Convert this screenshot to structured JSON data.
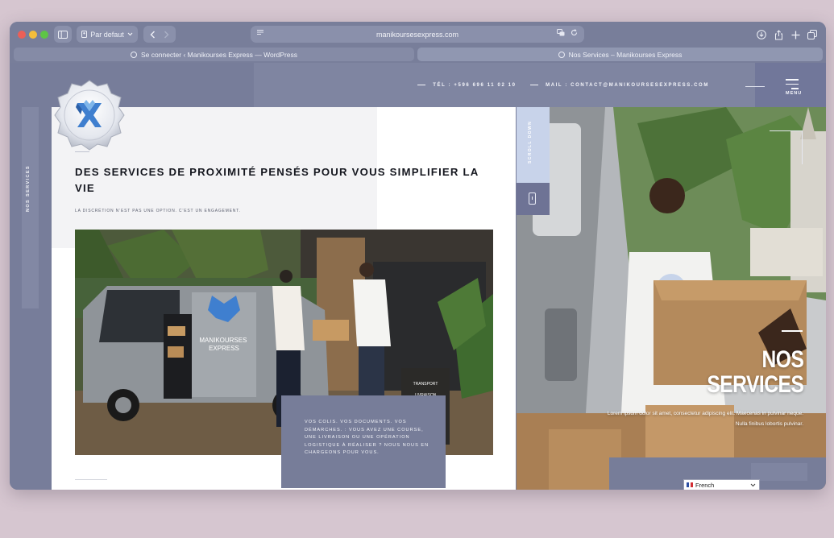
{
  "browser": {
    "profile_label": "Par defaut",
    "address": "manikoursesexpress.com",
    "tabs": [
      {
        "title": "Se connecter ‹ Manikourses Express — WordPress"
      },
      {
        "title": "Nos Services – Manikourses Express"
      }
    ]
  },
  "header": {
    "phone": "TÉL : +596 696 11 02 10",
    "email": "MAIL : CONTACT@MANIKOURSESEXPRESS.COM",
    "menu_label": "MENU"
  },
  "sidebar": {
    "label": "NOS SERVICES"
  },
  "main": {
    "heading": "DES SERVICES DE PROXIMITÉ PENSÉS POUR VOUS SIMPLIFIER LA VIE",
    "subheading": "LA DISCRÉTION N’EST PAS UNE OPTION. C’EST UN ENGAGEMENT.",
    "photo_van_text": "MANIKOURSES EXPRESS",
    "photo_sign_lines": [
      "TRANSPORT",
      "LIVRAISON"
    ],
    "card_text": "VOS COLIS. VOS DOCUMENTS. VOS DÉMARCHES. : VOUS AVEZ UNE COURSE, UNE LIVRAISON OU UNE OPÉRATION LOGISTIQUE À RÉALISER ? NOUS NOUS EN CHARGEONS POUR VOUS."
  },
  "scroll": {
    "label": "SCROLL DOWN"
  },
  "hero": {
    "title_line1": "NOS",
    "title_line2": "SERVICES",
    "lorem_line1": "Lorem ipsum dolor sit amet, consectetur adipiscing elit. Maecenas in pulvinar neque.",
    "lorem_line2": "Nulla finibus lobortis pulvinar."
  },
  "language": {
    "selected": "French"
  },
  "colors": {
    "accent": "#777d99",
    "scroll_accent": "#c8d3ea",
    "badge_blue": "#3f7fcf"
  },
  "icons": [
    "sidebar-toggle-icon",
    "back-icon",
    "forward-icon",
    "reader-icon",
    "translate-icon",
    "reload-icon",
    "download-icon",
    "share-icon",
    "new-tab-icon",
    "tab-overview-icon",
    "menu-icon",
    "mouse-scroll-icon",
    "chevron-down-icon"
  ]
}
